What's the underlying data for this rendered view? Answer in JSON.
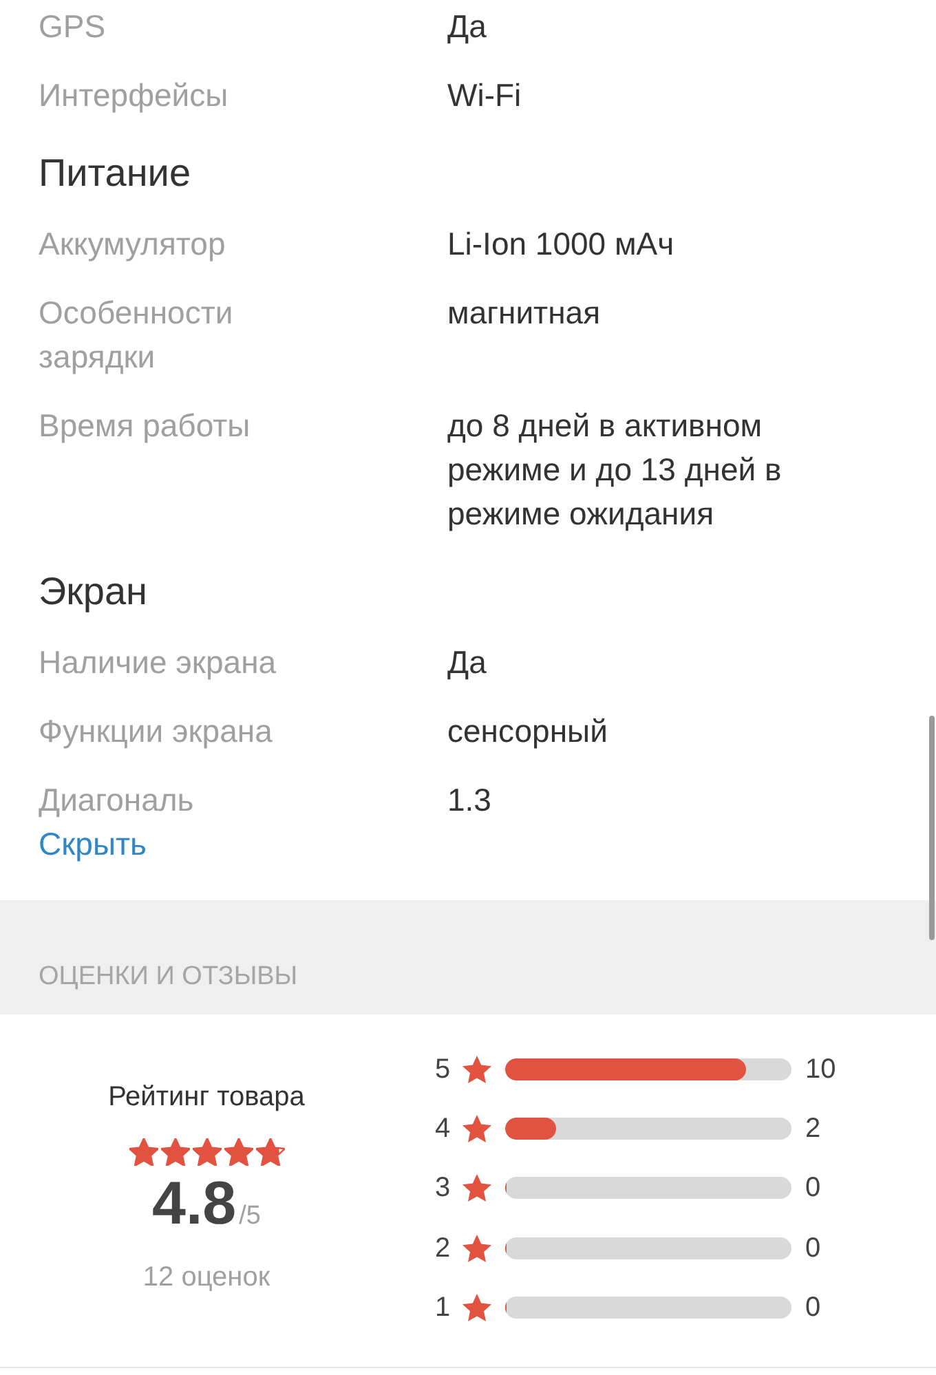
{
  "specs": [
    {
      "kind": "row",
      "label": "GPS",
      "value": "Да"
    },
    {
      "kind": "row",
      "label": "Интерфейсы",
      "value": "Wi-Fi"
    },
    {
      "kind": "heading",
      "title": "Питание"
    },
    {
      "kind": "row",
      "label": "Аккумулятор",
      "value": "Li-Ion 1000 мАч"
    },
    {
      "kind": "row",
      "label": "Особенности зарядки",
      "value": "магнитная"
    },
    {
      "kind": "row",
      "label": "Время работы",
      "value": "до 8 дней в активном режиме и до 13 дней в режиме ожидания"
    },
    {
      "kind": "heading",
      "title": "Экран"
    },
    {
      "kind": "row",
      "label": "Наличие экрана",
      "value": "Да"
    },
    {
      "kind": "row",
      "label": "Функции экрана",
      "value": "сенсорный"
    },
    {
      "kind": "row",
      "label": "Диагональ",
      "value": "1.3"
    }
  ],
  "hide_link": "Скрыть",
  "reviews": {
    "section_title": "ОЦЕНКИ И ОТЗЫВЫ",
    "rating_title": "Рейтинг товара",
    "stars": 4.8,
    "score": "4.8",
    "score_max": "/5",
    "count": "12 оценок",
    "breakdown": [
      {
        "grade": "5",
        "level": 0.84,
        "count": "10"
      },
      {
        "grade": "4",
        "level": 0.18,
        "count": "2"
      },
      {
        "grade": "3",
        "level": 0,
        "count": "0"
      },
      {
        "grade": "2",
        "level": 0,
        "count": "0"
      },
      {
        "grade": "1",
        "level": 0,
        "count": "0"
      }
    ]
  }
}
